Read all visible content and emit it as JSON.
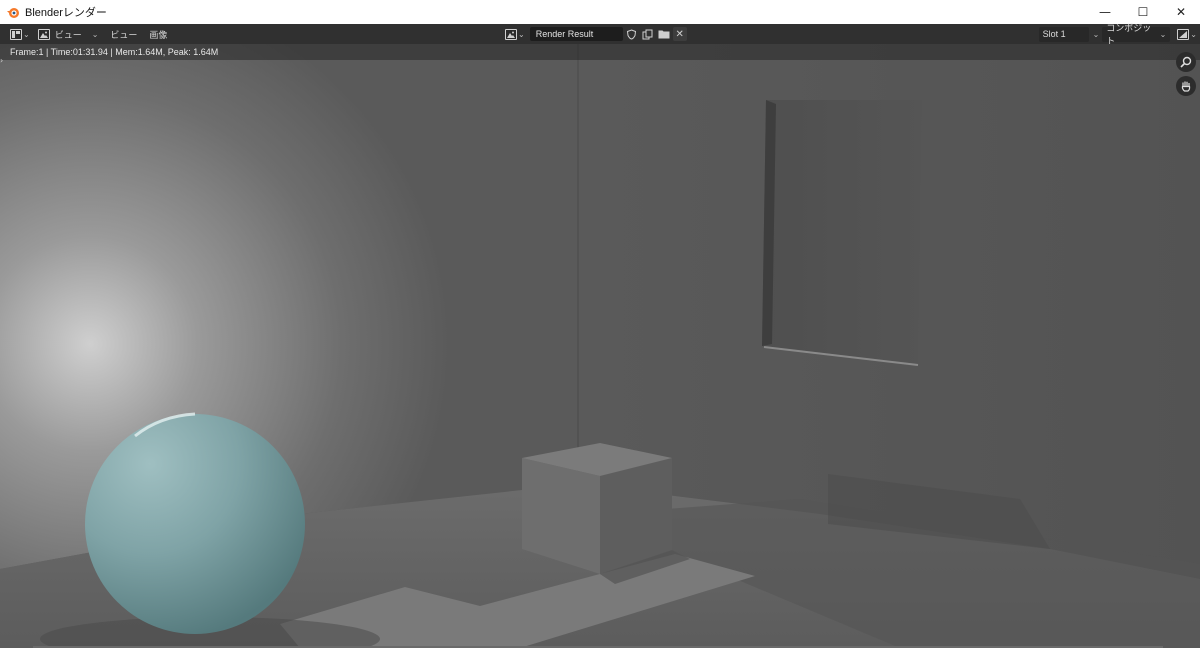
{
  "window": {
    "title": "Blenderレンダー",
    "controls": {
      "minimize": "—",
      "maximize": "☐",
      "close": "✕"
    }
  },
  "header": {
    "editor_type_icon": "image-editor-icon",
    "mode_icon": "image-icon",
    "view_dropdown_label": "ビュー",
    "menus": [
      "ビュー",
      "画像"
    ],
    "image_name": "Render Result",
    "slot": "Slot 1",
    "layer": "コンポジット"
  },
  "render": {
    "stats": "Frame:1 | Time:01:31.94 | Mem:1.64M, Peak: 1.64M",
    "nav_icons": [
      "zoom-icon",
      "hand-pan-icon"
    ]
  },
  "colors": {
    "header_bg": "#303030",
    "sphere": "#7fa3a6",
    "wall_left": "#6c6c6c",
    "wall_right": "#595959"
  }
}
